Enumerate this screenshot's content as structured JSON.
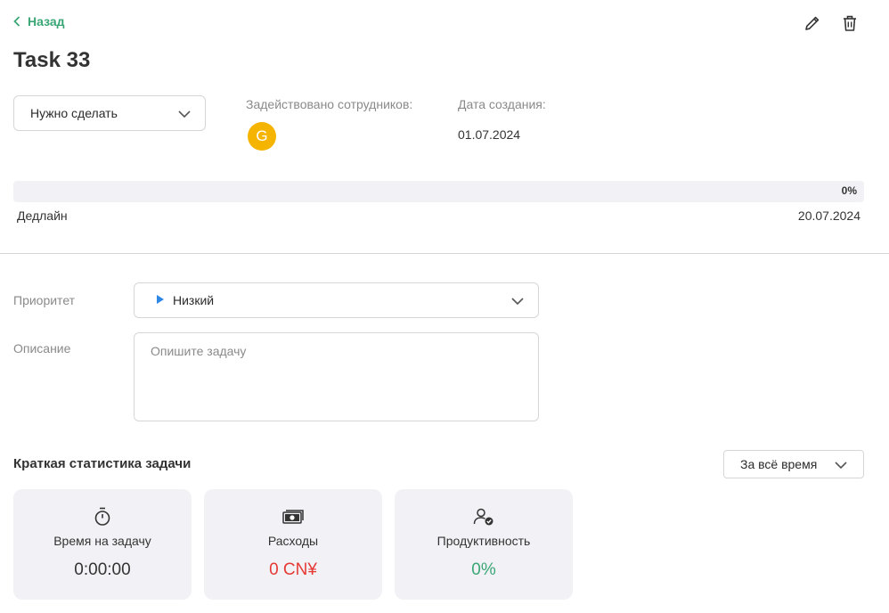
{
  "nav": {
    "back_label": "Назад"
  },
  "task": {
    "title": "Task 33"
  },
  "status": {
    "selected": "Нужно сделать"
  },
  "meta": {
    "employees_label": "Задействовано сотрудников:",
    "employee_initial": "G",
    "created_label": "Дата создания:",
    "created_value": "01.07.2024"
  },
  "progress": {
    "percent_label": "0%",
    "fraction": 0
  },
  "deadline": {
    "label": "Дедлайн",
    "value": "20.07.2024"
  },
  "form": {
    "priority_label": "Приоритет",
    "priority_value": "Низкий",
    "description_label": "Описание",
    "description_placeholder": "Опишите задачу",
    "description_value": ""
  },
  "stats": {
    "title": "Краткая статистика задачи",
    "period": "За всё время",
    "cards": [
      {
        "label": "Время на задачу",
        "value": "0:00:00",
        "icon": "stopwatch-icon",
        "color": "#333333"
      },
      {
        "label": "Расходы",
        "value": "0 CN¥",
        "icon": "cash-icon",
        "color": "#e53935"
      },
      {
        "label": "Продуктивность",
        "value": "0%",
        "icon": "user-check-icon",
        "color": "#3aa676"
      }
    ]
  },
  "colors": {
    "accent": "#3aa676",
    "avatar": "#f5b400",
    "expense": "#e53935",
    "priority_marker": "#2f86e4"
  }
}
